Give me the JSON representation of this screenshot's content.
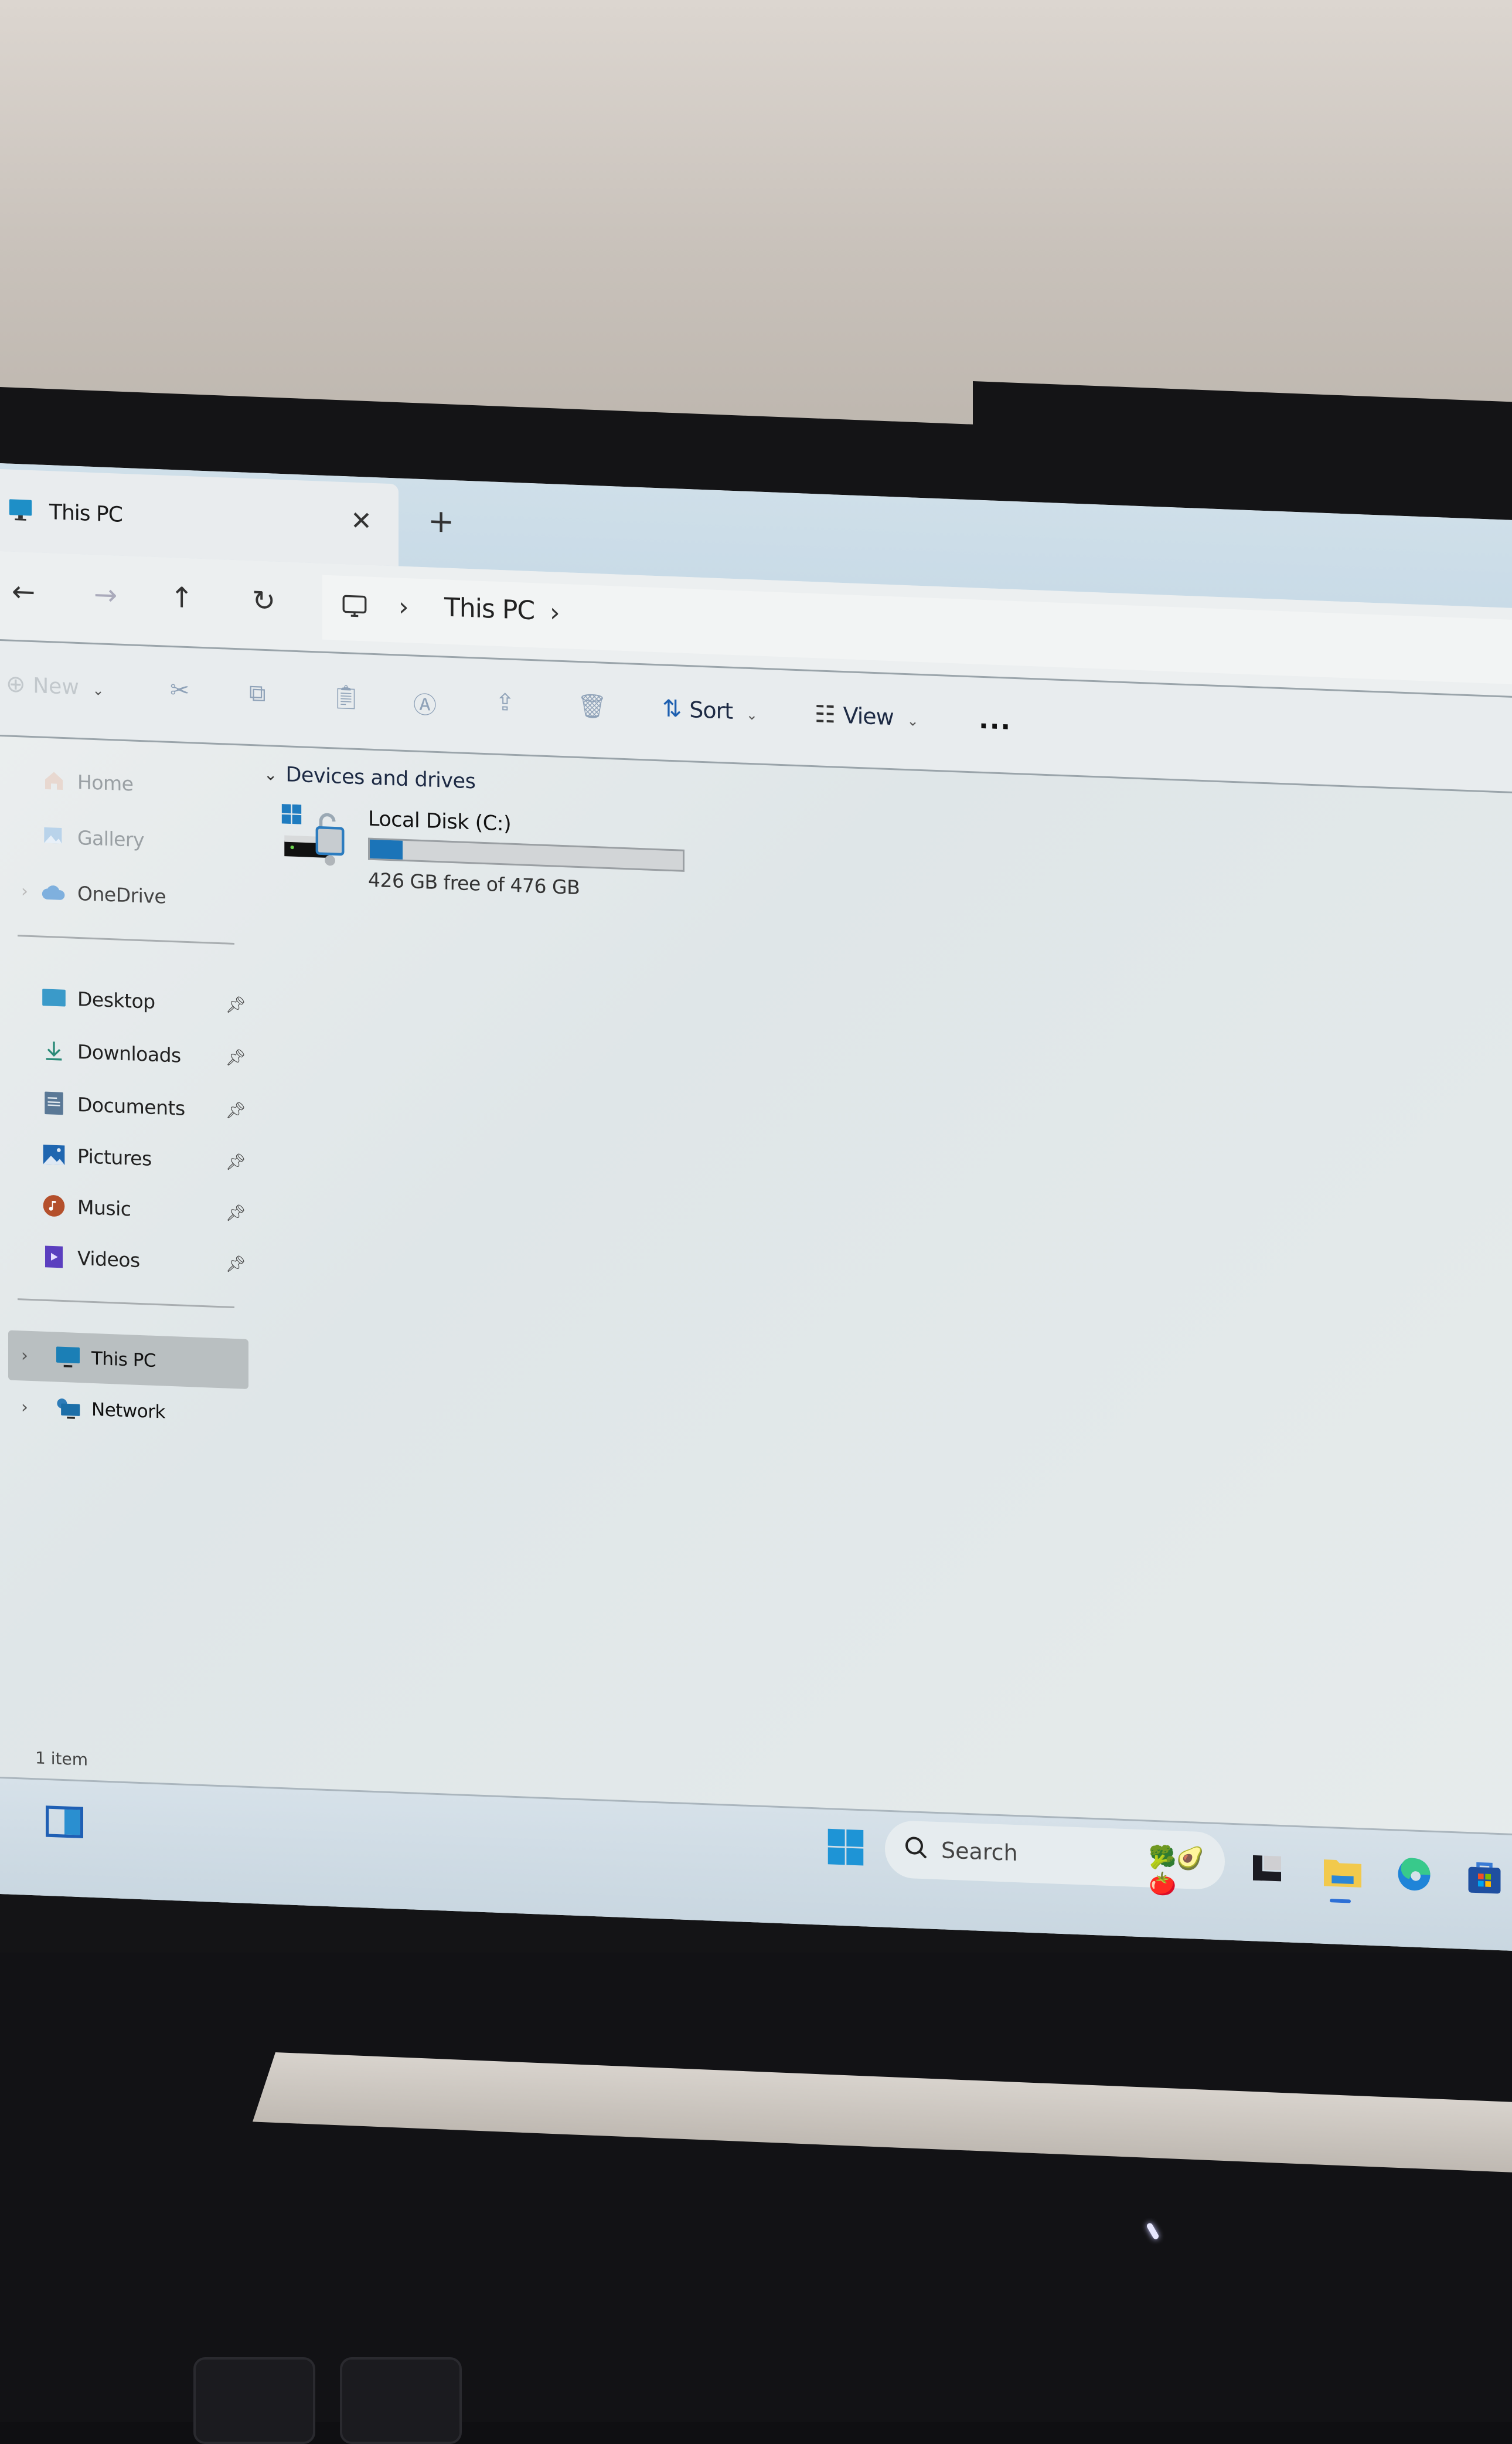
{
  "window": {
    "tab_title": "This PC",
    "new_tab_icon": "plus-icon",
    "close_tab_icon": "close-icon"
  },
  "navigation": {
    "back_icon": "arrow-left-icon",
    "forward_icon": "arrow-right-icon",
    "up_icon": "arrow-up-icon",
    "refresh_icon": "refresh-icon",
    "breadcrumb": [
      "This PC"
    ]
  },
  "toolbar": {
    "new_label": "New",
    "cut_icon": "cut-icon",
    "copy_icon": "copy-icon",
    "paste_icon": "paste-icon",
    "rename_icon": "rename-icon",
    "share_icon": "share-icon",
    "delete_icon": "delete-icon",
    "sort_label": "Sort",
    "view_label": "View",
    "more_label": "..."
  },
  "sidebar": {
    "top_items": [
      {
        "label": "Home",
        "icon": "home-icon"
      },
      {
        "label": "Gallery",
        "icon": "gallery-icon"
      },
      {
        "label": "OneDrive",
        "icon": "cloud-icon",
        "expandable": true
      }
    ],
    "quick_access": [
      {
        "label": "Desktop",
        "icon": "desktop-folder-icon",
        "pinned": true
      },
      {
        "label": "Downloads",
        "icon": "download-icon",
        "pinned": true
      },
      {
        "label": "Documents",
        "icon": "document-icon",
        "pinned": true
      },
      {
        "label": "Pictures",
        "icon": "pictures-icon",
        "pinned": true
      },
      {
        "label": "Music",
        "icon": "music-icon",
        "pinned": true
      },
      {
        "label": "Videos",
        "icon": "videos-icon",
        "pinned": true
      }
    ],
    "locations": [
      {
        "label": "This PC",
        "icon": "computer-icon",
        "selected": true,
        "expandable": true
      },
      {
        "label": "Network",
        "icon": "network-icon",
        "expandable": true
      }
    ]
  },
  "content": {
    "group_title": "Devices and drives",
    "drives": [
      {
        "name": "Local Disk (C:)",
        "free_text": "426 GB free of 476 GB",
        "free_gb": 426,
        "total_gb": 476,
        "used_fraction": 0.105
      }
    ]
  },
  "status": {
    "item_count": "1 item"
  },
  "taskbar": {
    "search_placeholder": "Search",
    "search_emoji": "🥦🥑🍅",
    "apps": [
      "widgets",
      "task-view",
      "file-explorer",
      "edge",
      "store"
    ],
    "accent": "#1b74b8"
  }
}
